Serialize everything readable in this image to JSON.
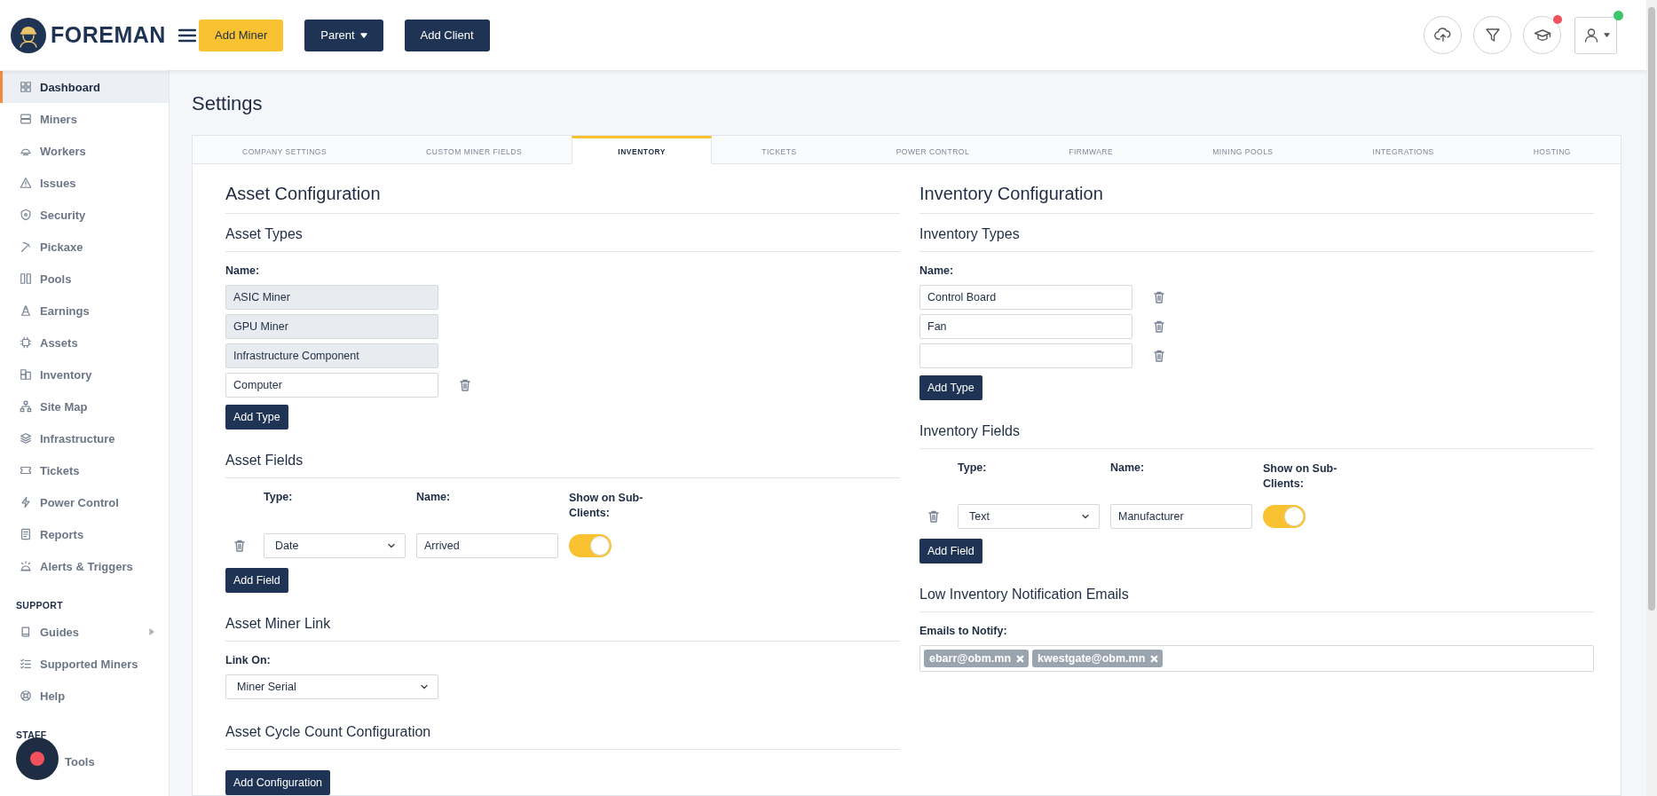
{
  "header": {
    "logo_text": "FOREMAN",
    "buttons": [
      {
        "label": "Add Miner",
        "kind": "accent"
      },
      {
        "label": "Parent",
        "kind": "dropdown"
      },
      {
        "label": "Add Client",
        "kind": "dark"
      }
    ],
    "icons": [
      {
        "kind": "upload"
      },
      {
        "kind": "filter"
      },
      {
        "kind": "learn",
        "alert": true
      },
      {
        "kind": "account",
        "online": true
      }
    ]
  },
  "sidebar": {
    "sections": [
      {
        "items": [
          {
            "label": "Dashboard",
            "selected": true
          },
          {
            "label": "Miners",
            "selected": false
          },
          {
            "label": "Workers",
            "selected": false
          },
          {
            "label": "Issues",
            "selected": false
          },
          {
            "label": "Security",
            "selected": false
          },
          {
            "label": "Pickaxe",
            "selected": false
          },
          {
            "label": "Pools",
            "selected": false
          },
          {
            "label": "Earnings",
            "selected": false
          },
          {
            "label": "Assets",
            "selected": false
          },
          {
            "label": "Inventory",
            "selected": false
          },
          {
            "label": "Site Map",
            "selected": false
          },
          {
            "label": "Infrastructure",
            "selected": false
          },
          {
            "label": "Tickets",
            "selected": false
          },
          {
            "label": "Power Control",
            "selected": false
          },
          {
            "label": "Reports",
            "selected": false
          },
          {
            "label": "Alerts & Triggers",
            "selected": false
          }
        ]
      },
      {
        "heading": "SUPPORT",
        "items": [
          {
            "label": "Guides",
            "selected": false,
            "expandable": true
          },
          {
            "label": "Supported Miners",
            "selected": false
          },
          {
            "label": "Help",
            "selected": false
          }
        ]
      },
      {
        "heading": "STAFF",
        "items": [
          {
            "label": "Tools",
            "selected": false
          }
        ]
      }
    ]
  },
  "page_title": "Settings",
  "tabs": [
    {
      "label": "COMPANY SETTINGS",
      "selected": false
    },
    {
      "label": "CUSTOM MINER FIELDS",
      "selected": false
    },
    {
      "label": "INVENTORY",
      "selected": true
    },
    {
      "label": "TICKETS",
      "selected": false
    },
    {
      "label": "POWER CONTROL",
      "selected": false
    },
    {
      "label": "FIRMWARE",
      "selected": false
    },
    {
      "label": "MINING POOLS",
      "selected": false
    },
    {
      "label": "INTEGRATIONS",
      "selected": false
    },
    {
      "label": "HOSTING",
      "selected": false
    }
  ],
  "asset_configuration": {
    "title": "Asset Configuration",
    "types": {
      "title": "Asset Types",
      "name_label": "Name:",
      "add_button": "Add Type",
      "items": [
        {
          "value": "ASIC Miner",
          "disabled": true
        },
        {
          "value": "GPU Miner",
          "disabled": true
        },
        {
          "value": "Infrastructure Component",
          "disabled": true
        },
        {
          "value": "Computer",
          "disabled": false
        }
      ]
    },
    "fields": {
      "title": "Asset Fields",
      "columns": [
        "Type:",
        "Name:",
        "Show on Sub-Clients:"
      ],
      "add_button": "Add Field",
      "rows": [
        {
          "type": "Date",
          "name": "Arrived",
          "show_on_sub_clients": true
        }
      ]
    },
    "miner_link": {
      "title": "Asset Miner Link",
      "label": "Link On:",
      "value": "Miner Serial"
    },
    "cycle_count": {
      "title": "Asset Cycle Count Configuration",
      "add_button": "Add Configuration"
    }
  },
  "inventory_configuration": {
    "title": "Inventory Configuration",
    "types": {
      "title": "Inventory Types",
      "name_label": "Name:",
      "add_button": "Add Type",
      "items": [
        {
          "value": "Control Board",
          "disabled": false
        },
        {
          "value": "Fan",
          "disabled": false
        },
        {
          "disabled": false
        }
      ]
    },
    "fields": {
      "title": "Inventory Fields",
      "columns": [
        "Type:",
        "Name:",
        "Show on Sub-Clients:"
      ],
      "add_button": "Add Field",
      "rows": [
        {
          "type": "Text",
          "name": "Manufacturer",
          "show_on_sub_clients": true
        }
      ]
    },
    "notifications": {
      "title": "Low Inventory Notification Emails",
      "label": "Emails to Notify:",
      "emails": [
        "ebarr@obm.mn",
        "kwestgate@obm.mn"
      ]
    }
  }
}
